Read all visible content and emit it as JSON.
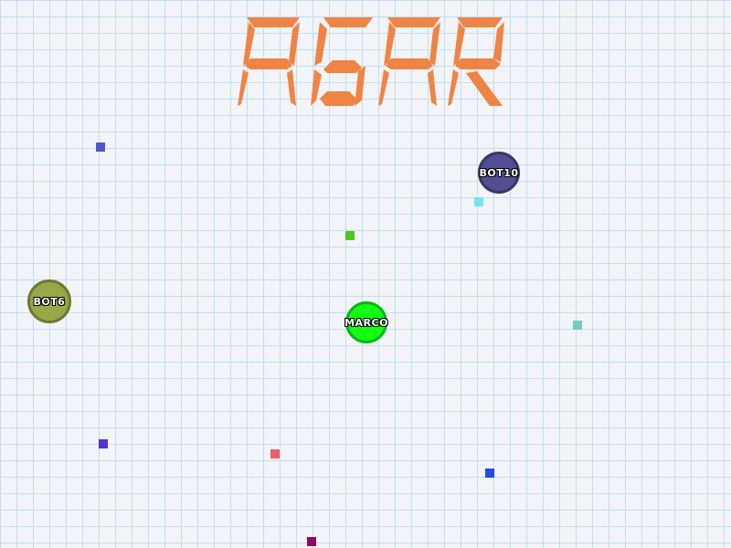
{
  "logo": {
    "text": "AGAR",
    "color": "#f08445"
  },
  "cells": {
    "bot10": {
      "name": "BOT10",
      "color": "#514e92"
    },
    "bot6": {
      "name": "BOT6",
      "color": "#9aa749"
    },
    "marco": {
      "name": "MARCO",
      "color": "#12ff12"
    }
  },
  "pellets": [
    {
      "color": "#4f57cf"
    },
    {
      "color": "#71e4fa"
    },
    {
      "color": "#4fc61b"
    },
    {
      "color": "#6fcfc0"
    },
    {
      "color": "#5232d6"
    },
    {
      "color": "#eb5c6c"
    },
    {
      "color": "#2149f0"
    },
    {
      "color": "#8a0c5c"
    }
  ]
}
